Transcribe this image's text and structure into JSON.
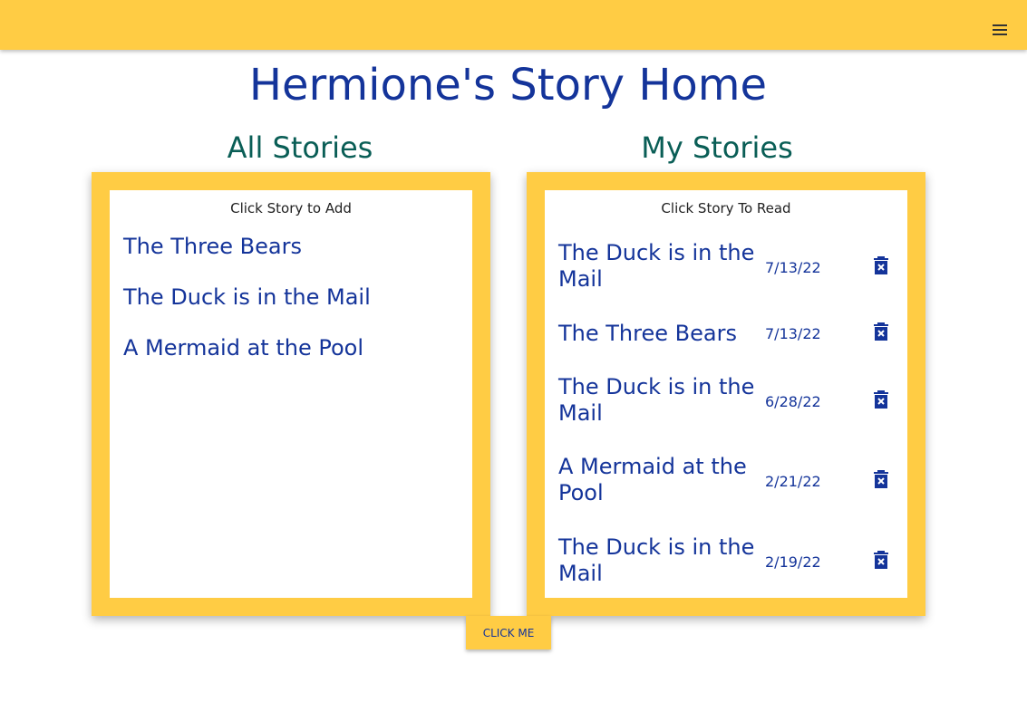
{
  "header": {
    "menu_icon": "menu-icon"
  },
  "page_title": "Hermione's Story Home",
  "all_stories": {
    "heading": "All Stories",
    "instruction": "Click Story to Add",
    "items": [
      "The Three Bears",
      "The Duck is in the Mail",
      "A Mermaid at the Pool"
    ]
  },
  "my_stories": {
    "heading": "My Stories",
    "instruction": "Click Story To Read",
    "items": [
      {
        "title": "The Duck is in the Mail",
        "date": "7/13/22"
      },
      {
        "title": "The Three Bears",
        "date": "7/13/22"
      },
      {
        "title": "The Duck is in the Mail",
        "date": "6/28/22"
      },
      {
        "title": "A Mermaid at the Pool",
        "date": "2/21/22"
      },
      {
        "title": "The Duck is in the Mail",
        "date": "2/19/22"
      }
    ],
    "delete_icon": "delete-icon"
  },
  "click_button": "CLICK ME",
  "colors": {
    "accent": "#ffcc44",
    "primary_text": "#14349a",
    "section_heading": "#0a5e56"
  }
}
